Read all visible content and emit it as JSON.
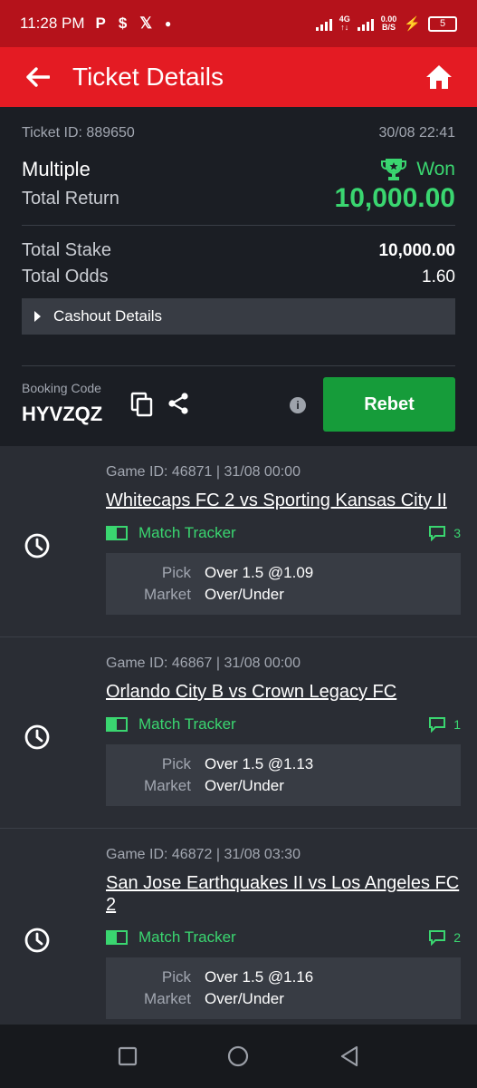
{
  "status_bar": {
    "time": "11:28 PM",
    "network": "4G",
    "speed": "0.00",
    "speed_unit": "B/S",
    "battery": "5",
    "icons": [
      "p-icon",
      "s-icon",
      "x-icon",
      "dot-icon"
    ]
  },
  "header": {
    "title": "Ticket Details"
  },
  "ticket": {
    "id_label": "Ticket ID: 889650",
    "datetime": "30/08 22:41",
    "type": "Multiple",
    "status": "Won",
    "total_return_label": "Total Return",
    "total_return": "10,000.00",
    "total_stake_label": "Total Stake",
    "total_stake": "10,000.00",
    "total_odds_label": "Total Odds",
    "total_odds": "1.60",
    "cashout_label": "Cashout Details"
  },
  "booking": {
    "label": "Booking Code",
    "code": "HYVZQZ",
    "rebet_label": "Rebet"
  },
  "games": [
    {
      "game_id": "Game ID: 46871 | 31/08 00:00",
      "match": "Whitecaps FC 2 vs Sporting Kansas City II",
      "tracker": "Match Tracker",
      "comments": "3",
      "pick_label": "Pick",
      "pick": "Over 1.5 @1.09",
      "market_label": "Market",
      "market": "Over/Under"
    },
    {
      "game_id": "Game ID: 46867 | 31/08 00:00",
      "match": "Orlando City B vs Crown Legacy FC",
      "tracker": "Match Tracker",
      "comments": "1",
      "pick_label": "Pick",
      "pick": "Over 1.5 @1.13",
      "market_label": "Market",
      "market": "Over/Under"
    },
    {
      "game_id": "Game ID: 46872 | 31/08 03:30",
      "match": "San Jose Earthquakes II vs Los Angeles FC 2",
      "tracker": "Match Tracker",
      "comments": "2",
      "pick_label": "Pick",
      "pick": "Over 1.5 @1.16",
      "market_label": "Market",
      "market": "Over/Under"
    }
  ],
  "colors": {
    "brand_red": "#e41b23",
    "status_red": "#b5121b",
    "win_green": "#3ad670",
    "rebet_green": "#169c3a"
  }
}
